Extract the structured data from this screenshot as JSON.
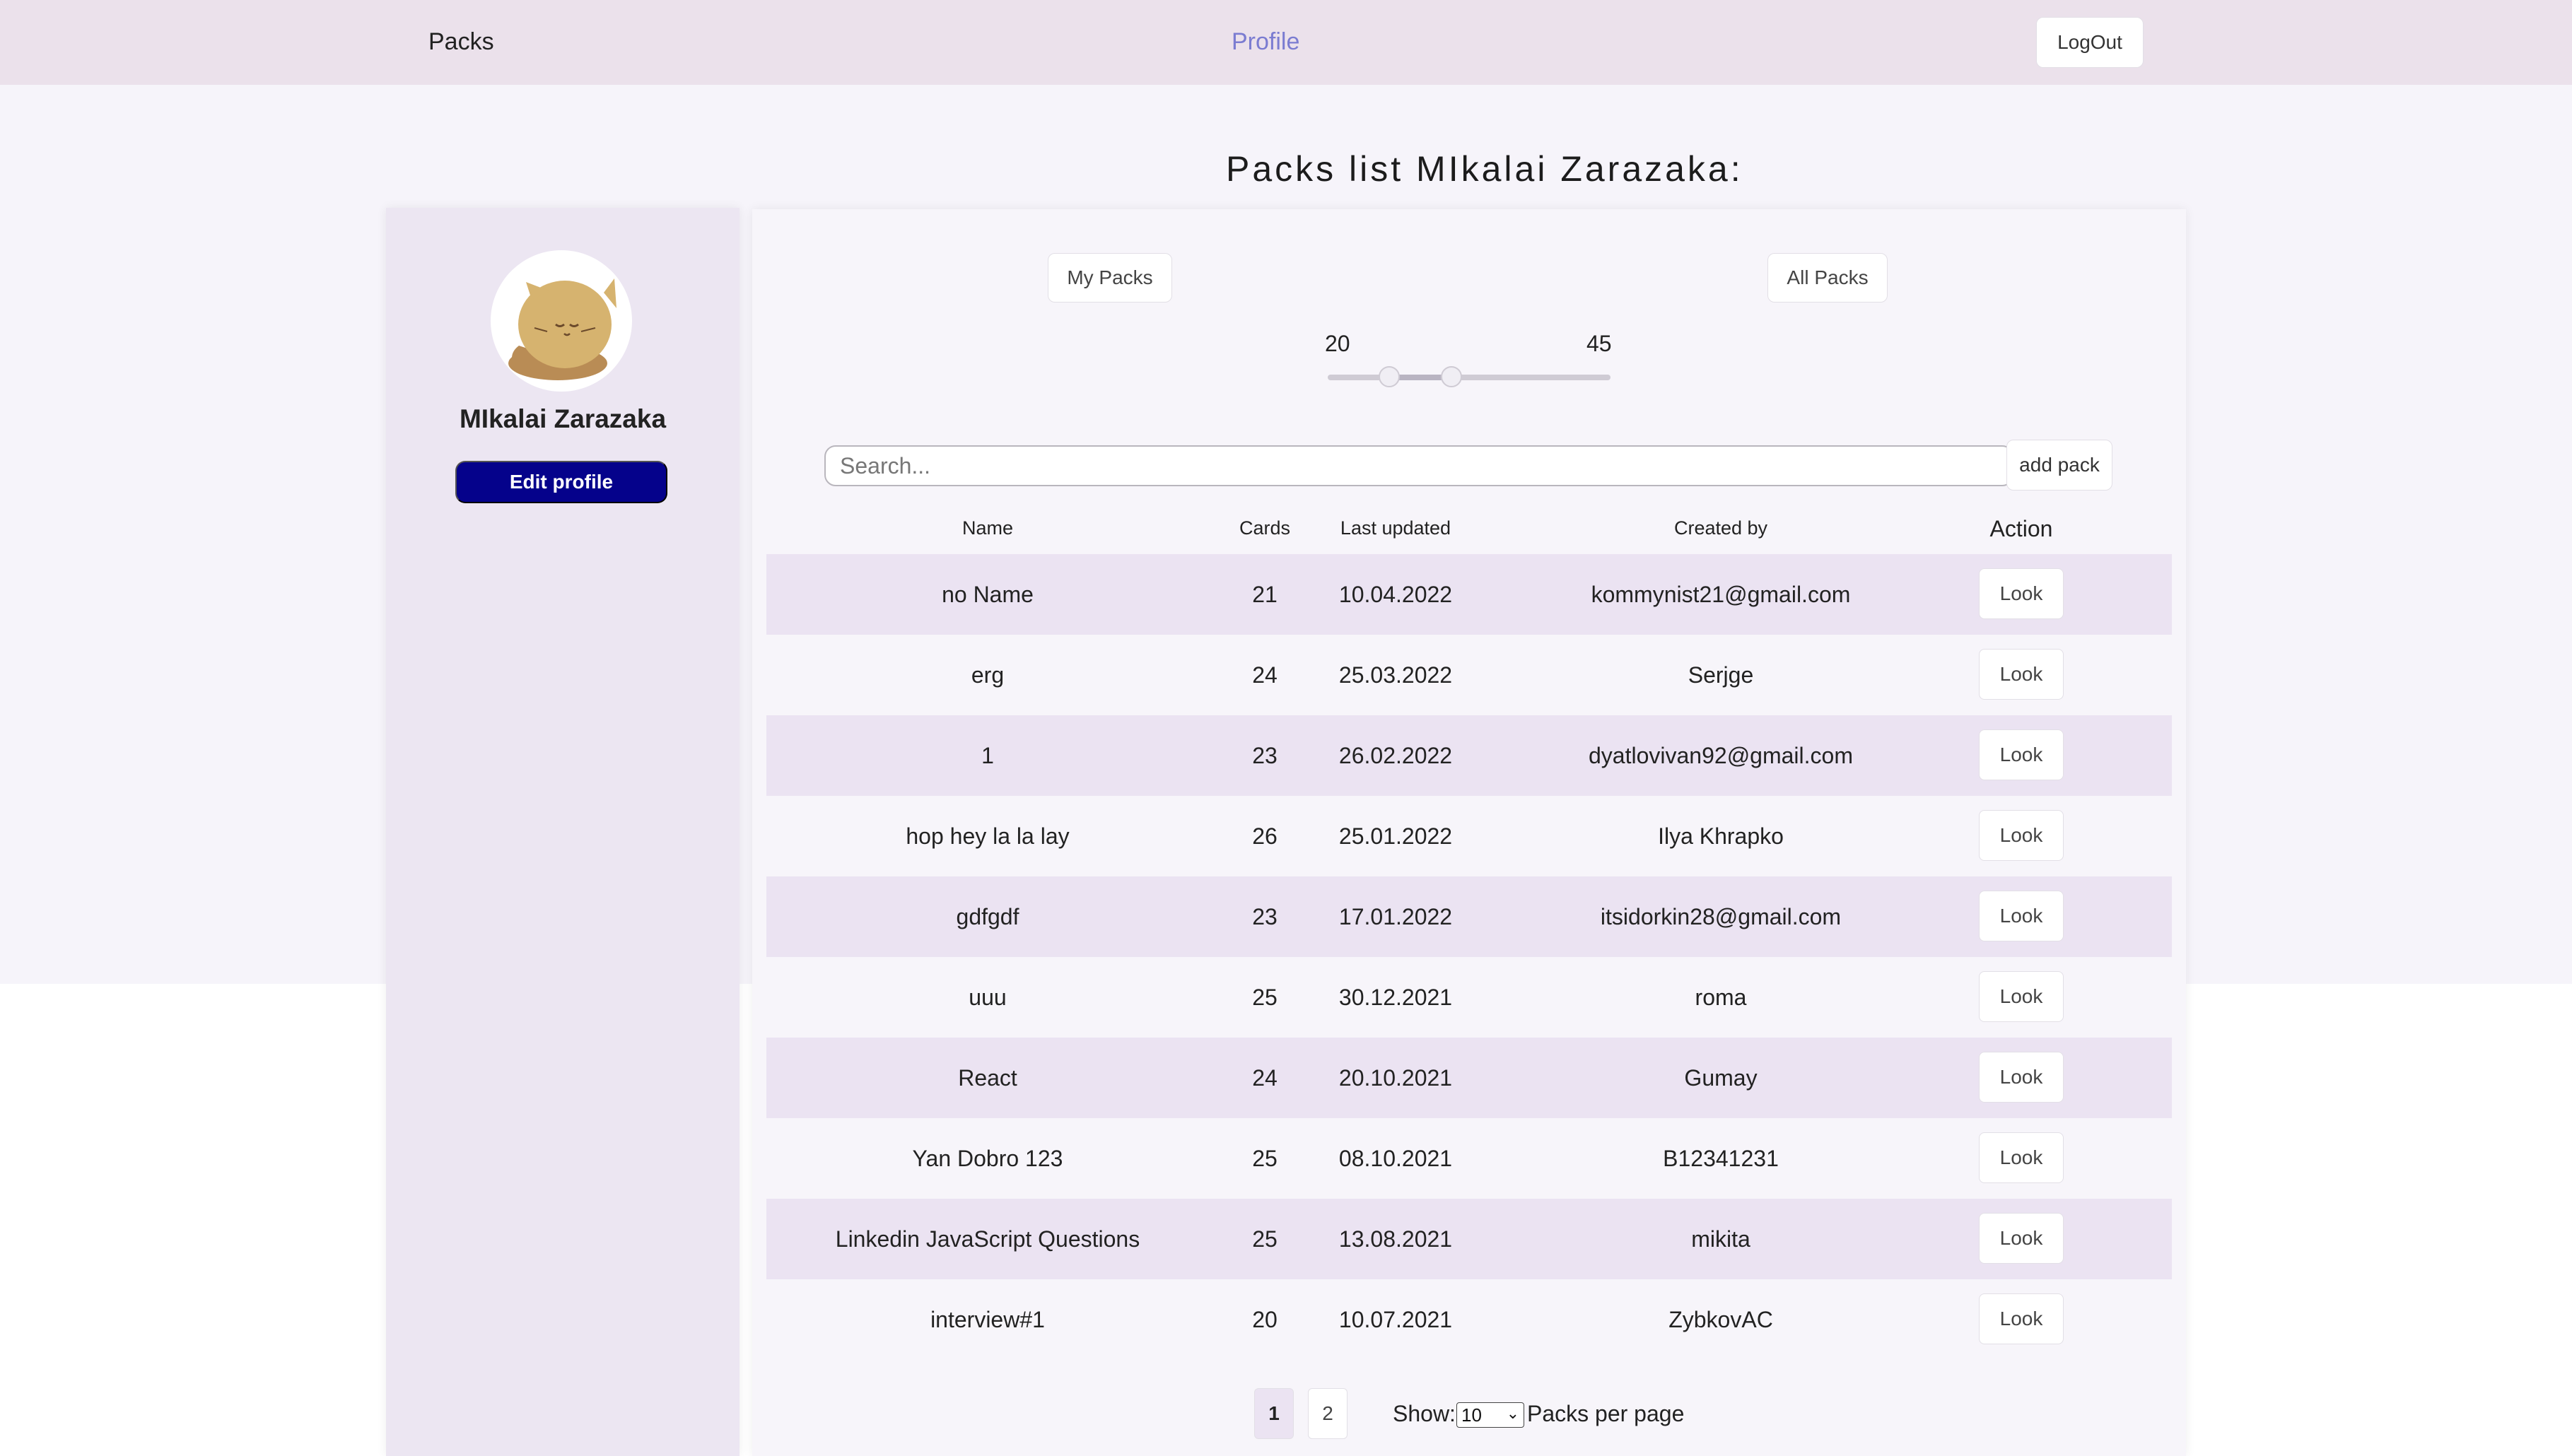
{
  "header": {
    "nav_packs": "Packs",
    "nav_profile": "Profile",
    "logout_label": "LogOut"
  },
  "page_title": "Packs list MIkalai Zarazaka:",
  "profile": {
    "name": "MIkalai Zarazaka",
    "edit_label": "Edit profile",
    "avatar_icon": "cat-avatar-icon"
  },
  "filters": {
    "my_packs_label": "My Packs",
    "all_packs_label": "All Packs",
    "range_min": "20",
    "range_max": "45"
  },
  "search": {
    "placeholder": "Search...",
    "add_label": "add pack"
  },
  "table": {
    "headers": {
      "name": "Name",
      "cards": "Cards",
      "updated": "Last updated",
      "created": "Created by",
      "action": "Action"
    },
    "rows": [
      {
        "name": "no Name",
        "cards": "21",
        "updated": "10.04.2022",
        "created": "kommynist21@gmail.com",
        "action": "Look"
      },
      {
        "name": "erg",
        "cards": "24",
        "updated": "25.03.2022",
        "created": "Serjge",
        "action": "Look"
      },
      {
        "name": "1",
        "cards": "23",
        "updated": "26.02.2022",
        "created": "dyatlovivan92@gmail.com",
        "action": "Look"
      },
      {
        "name": "hop hey la la lay",
        "cards": "26",
        "updated": "25.01.2022",
        "created": "Ilya Khrapko",
        "action": "Look"
      },
      {
        "name": "gdfgdf",
        "cards": "23",
        "updated": "17.01.2022",
        "created": "itsidorkin28@gmail.com",
        "action": "Look"
      },
      {
        "name": "uuu",
        "cards": "25",
        "updated": "30.12.2021",
        "created": "roma",
        "action": "Look"
      },
      {
        "name": "React",
        "cards": "24",
        "updated": "20.10.2021",
        "created": "Gumay",
        "action": "Look"
      },
      {
        "name": "Yan Dobro 123",
        "cards": "25",
        "updated": "08.10.2021",
        "created": "B12341231",
        "action": "Look"
      },
      {
        "name": "Linkedin JavaScript Questions",
        "cards": "25",
        "updated": "13.08.2021",
        "created": "mikita",
        "action": "Look"
      },
      {
        "name": "interview#1",
        "cards": "20",
        "updated": "10.07.2021",
        "created": "ZybkovAC",
        "action": "Look"
      }
    ]
  },
  "pagination": {
    "pages": [
      "1",
      "2"
    ],
    "current": "1",
    "show_label": "Show:",
    "per_page_value": "10",
    "per_page_label": "Packs per page"
  },
  "colors": {
    "header_bg": "#ebe1eb",
    "accent_link": "#7b7cd1",
    "edit_button": "#05028b",
    "row_shade": "#ebe3f2"
  }
}
